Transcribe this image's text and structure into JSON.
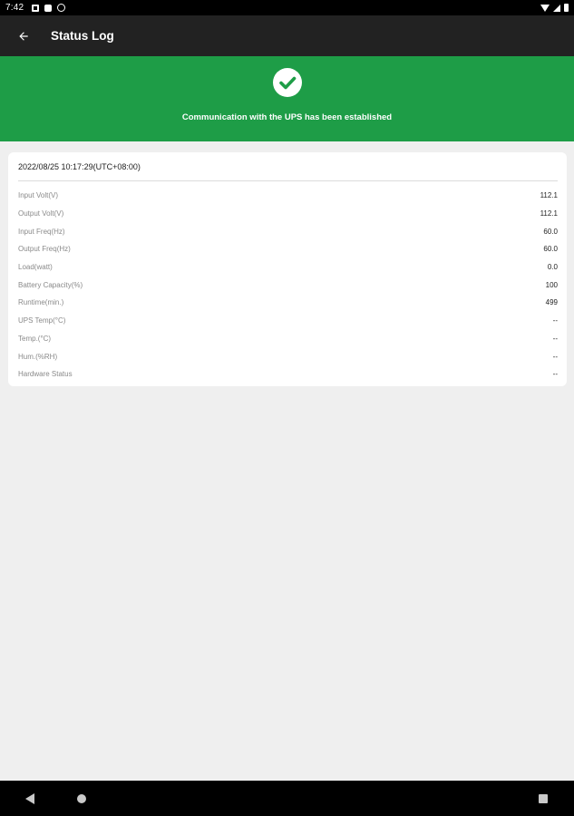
{
  "status_bar": {
    "time": "7:42",
    "icons": [
      "notification-icon",
      "sim-icon",
      "sync-icon",
      "wifi-icon",
      "signal-icon",
      "battery-icon"
    ]
  },
  "app_bar": {
    "title": "Status Log",
    "back_icon": "arrow-back-icon"
  },
  "banner": {
    "icon": "check-circle-icon",
    "message": "Communication with the UPS has been established",
    "color": "#1e9d47"
  },
  "log": {
    "timestamp": "2022/08/25 10:17:29(UTC+08:00)",
    "rows": [
      {
        "label": "Input Volt(V)",
        "value": "112.1"
      },
      {
        "label": "Output Volt(V)",
        "value": "112.1"
      },
      {
        "label": "Input Freq(Hz)",
        "value": "60.0"
      },
      {
        "label": "Output Freq(Hz)",
        "value": "60.0"
      },
      {
        "label": "Load(watt)",
        "value": "0.0"
      },
      {
        "label": "Battery Capacity(%)",
        "value": "100"
      },
      {
        "label": "Runtime(min.)",
        "value": "499"
      },
      {
        "label": "UPS Temp(°C)",
        "value": "--"
      },
      {
        "label": "Temp.(°C)",
        "value": "--"
      },
      {
        "label": "Hum.(%RH)",
        "value": "--"
      },
      {
        "label": "Hardware Status",
        "value": "--"
      }
    ]
  },
  "nav_bar": {
    "icons": [
      "nav-back-icon",
      "nav-home-icon",
      "nav-recents-icon"
    ]
  }
}
